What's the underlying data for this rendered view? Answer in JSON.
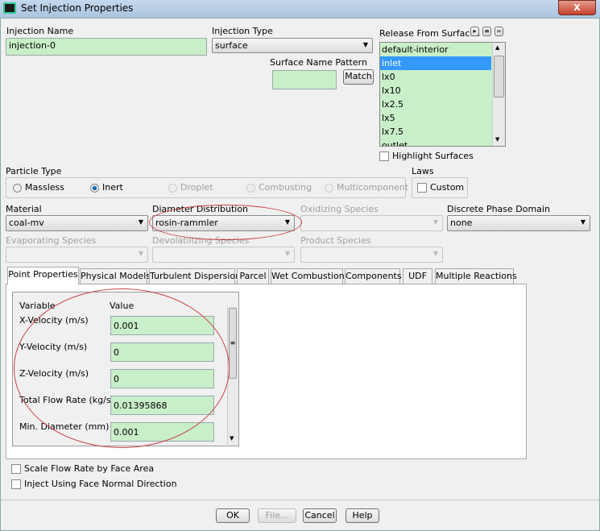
{
  "window": {
    "title": "Set Injection Properties",
    "close_label": "X"
  },
  "injection_name": {
    "label": "Injection Name",
    "value": "injection-0"
  },
  "injection_type": {
    "label": "Injection Type",
    "value": "surface"
  },
  "surface_name_pattern": {
    "label": "Surface Name Pattern",
    "value": "",
    "match_label": "Match"
  },
  "release_from_surfaces": {
    "label": "Release From Surfaces",
    "items": [
      "default-interior",
      "inlet",
      "lx0",
      "lx10",
      "lx2.5",
      "lx5",
      "lx7.5",
      "outlet"
    ],
    "selected": "inlet"
  },
  "highlight_surfaces": {
    "label": "Highlight Surfaces",
    "checked": false
  },
  "particle_type": {
    "label": "Particle Type",
    "options": [
      "Massless",
      "Inert",
      "Droplet",
      "Combusting",
      "Multicomponent"
    ],
    "selected": "Inert"
  },
  "laws": {
    "label": "Laws",
    "custom_label": "Custom",
    "checked": false
  },
  "material": {
    "label": "Material",
    "value": "coal-mv"
  },
  "diameter_distribution": {
    "label": "Diameter Distribution",
    "value": "rosin-rammler"
  },
  "oxidizing_species": {
    "label": "Oxidizing Species",
    "value": ""
  },
  "discrete_phase_domain": {
    "label": "Discrete Phase Domain",
    "value": "none"
  },
  "evaporating_species": {
    "label": "Evaporating Species",
    "value": ""
  },
  "devolatilizing_species": {
    "label": "Devolatilizing Species",
    "value": ""
  },
  "product_species": {
    "label": "Product Species",
    "value": ""
  },
  "tabs": [
    "Point Properties",
    "Physical Models",
    "Turbulent Dispersion",
    "Parcel",
    "Wet Combustion",
    "Components",
    "UDF",
    "Multiple Reactions"
  ],
  "active_tab": "Point Properties",
  "point_properties": {
    "header_variable": "Variable",
    "header_value": "Value",
    "rows": [
      {
        "label": "X-Velocity (m/s)",
        "value": "0.001"
      },
      {
        "label": "Y-Velocity (m/s)",
        "value": "0"
      },
      {
        "label": "Z-Velocity (m/s)",
        "value": "0"
      },
      {
        "label": "Total Flow Rate (kg/s)",
        "value": "0.01395868"
      },
      {
        "label": "Min. Diameter (mm)",
        "value": "0.001"
      }
    ]
  },
  "scale_flow_rate": {
    "label": "Scale Flow Rate by Face Area",
    "checked": false
  },
  "inject_face_normal": {
    "label": "Inject Using Face Normal Direction",
    "checked": false
  },
  "buttons": {
    "ok": "OK",
    "file": "File...",
    "cancel": "Cancel",
    "help": "Help"
  }
}
